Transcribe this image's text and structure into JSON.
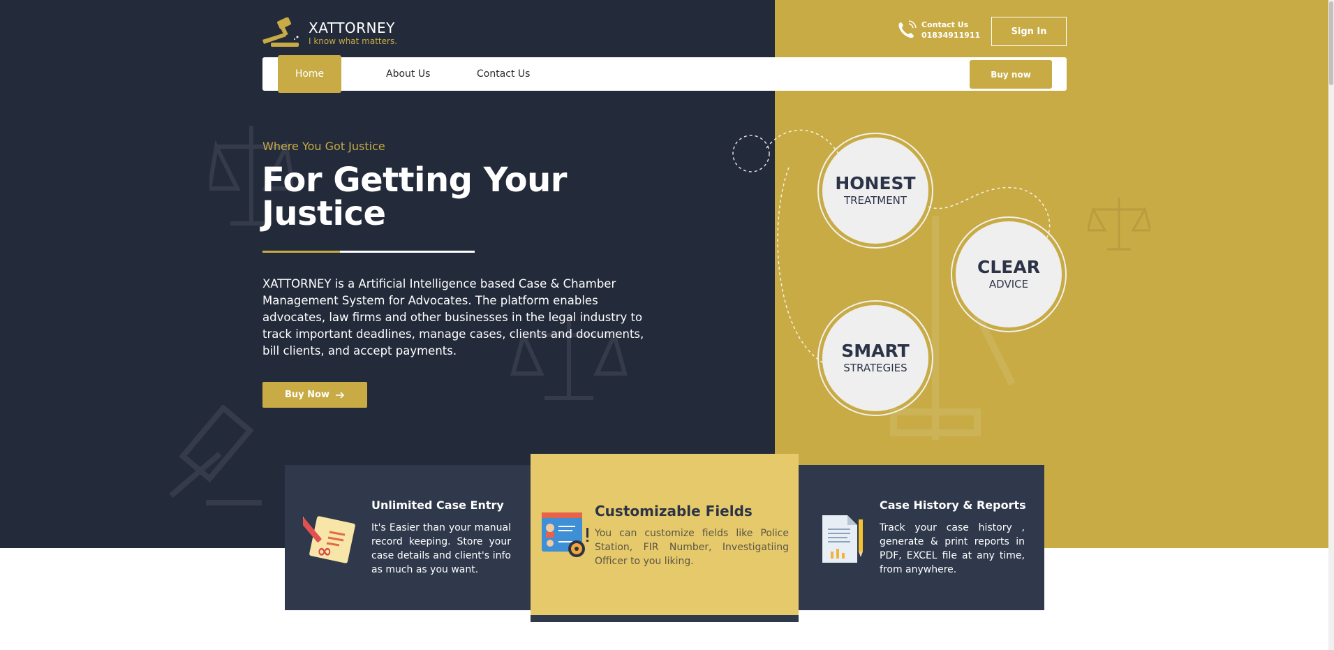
{
  "brand": {
    "name": "XATTORNEY",
    "tagline": "I know what matters."
  },
  "header": {
    "contact_label": "Contact Us",
    "contact_phone": "01834911911",
    "signin_label": "Sign In"
  },
  "nav": {
    "items": [
      {
        "label": "Home",
        "active": true
      },
      {
        "label": "About Us",
        "active": false
      },
      {
        "label": "Contact Us",
        "active": false
      }
    ],
    "buy_label": "Buy now"
  },
  "hero": {
    "eyebrow": "Where You Got Justice",
    "title": "For Getting Your Justice",
    "description": "XATTORNEY is a Artificial Intelligence based Case & Chamber Management System for Advocates. The platform enables advocates, law firms and other businesses in the legal industry to track important deadlines, manage cases, clients and documents, bill clients, and accept payments.",
    "cta_label": "Buy Now"
  },
  "values": [
    {
      "big": "HONEST",
      "small": "TREATMENT"
    },
    {
      "big": "CLEAR",
      "small": "ADVICE"
    },
    {
      "big": "SMART",
      "small": "STRATEGIES"
    }
  ],
  "features": [
    {
      "title": "Unlimited Case Entry",
      "text": "It's Easier than your manual record keeping. Store your case details and client's info as much as you want.",
      "icon": "notepad-pencil-icon"
    },
    {
      "title": "Customizable Fields",
      "text": "You can customize fields like Police Station, FIR Number, Investigatiing Officer to you liking.",
      "icon": "settings-profile-icon"
    },
    {
      "title": "Case History & Reports",
      "text": "Track your case history , generate & print reports in PDF, EXCEL file at any time, from anywhere.",
      "icon": "report-document-icon"
    }
  ],
  "colors": {
    "dark": "#232a3a",
    "gold": "#c8ab45",
    "card_dark": "#2f394b",
    "card_gold": "#e6c96a"
  }
}
